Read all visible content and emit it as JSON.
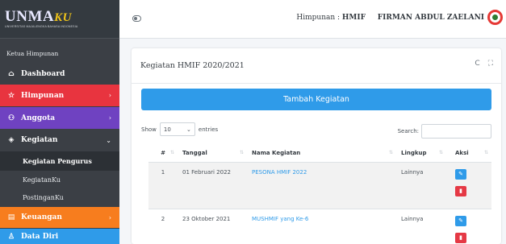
{
  "brand": {
    "name": "UNMA",
    "suffix": "KU",
    "tagline": "UNIVERSITAS MAJALENGKA BAHASA INDONESIA"
  },
  "sidebar": {
    "role_label": "Ketua Himpunan",
    "items": [
      {
        "label": "Dashboard",
        "icon": "home-icon"
      },
      {
        "label": "Himpunan",
        "icon": "star-icon",
        "chevron": "›",
        "color": "#e8343f"
      },
      {
        "label": "Anggota",
        "icon": "users-icon",
        "chevron": "›",
        "color": "#6f42c1"
      },
      {
        "label": "Kegiatan",
        "icon": "layers-icon",
        "chevron": "⌄"
      },
      {
        "label": "Keuangan",
        "icon": "wallet-icon",
        "chevron": "›",
        "color": "#f77d1e"
      },
      {
        "label": "Data Diri",
        "icon": "user-icon",
        "color": "#2f9be9"
      }
    ],
    "sub_items": [
      "Kegiatan Pengurus",
      "KegiatanKu",
      "PostinganKu"
    ]
  },
  "topbar": {
    "himpunan_label": "Himpunan : ",
    "himpunan_value": "HMIF",
    "user_name": "FIRMAN ABDUL ZAELANI"
  },
  "card": {
    "title": "Kegiatan HMIF 2020/2021",
    "refresh_icon": "C",
    "expand_icon": "⛶",
    "add_button": "Tambah Kegiatan",
    "show_label": "Show",
    "entries_value": "10",
    "entries_label": "entries",
    "search_label": "Search:"
  },
  "table": {
    "headers": [
      "#",
      "Tanggal",
      "Nama Kegiatan",
      "Lingkup",
      "Aksi"
    ],
    "rows": [
      {
        "no": "1",
        "tanggal": "01 Februari 2022",
        "nama": "PESONA HMIF 2022",
        "lingkup": "Lainnya"
      },
      {
        "no": "2",
        "tanggal": "23 Oktober 2021",
        "nama": "MUSHMIF yang Ke-6",
        "lingkup": "Lainnya"
      }
    ]
  },
  "colors": {
    "primary": "#2f9be9",
    "danger": "#e53945",
    "sidebar": "#3b3f45"
  }
}
